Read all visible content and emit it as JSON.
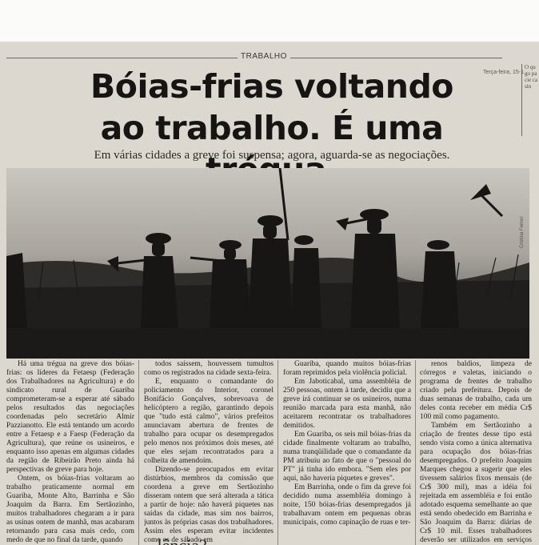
{
  "section": "TRABALHO",
  "date": "Terça-feira, 15-1",
  "headline": {
    "line1": "Bóias-frias voltando",
    "line2": "ao trabalho. É uma trégua."
  },
  "subhead": "Em várias cidades a greve foi suspensa; agora, aguarda-se as negociações.",
  "photo_credit": "Cristina Ferreri",
  "columns": [
    [
      "Há uma trégua na greve dos bóias-frias: os líderes da Fetaesp (Federação dos Trabalhadores na Agricultura) e do sindicato rural de Guariba comprometeram-se a esperar até sábado pelos resultados das negociações coordenadas pelo secretário Almir Pazzianotto. Ele está tentando um acordo entre a Fetaesp e a Faesp (Federação da Agricultura), que reúne os usineiros, e enquanto isso apenas em algumas cidades da região de Ribeirão Preto ainda há perspectivas de greve para hoje.",
      "Ontem, os bóias-frias voltaram ao trabalho praticamente normal em Guariba, Monte Alto, Barrinha e São Joaquim da Barra. Em Sertãozinho, muitos trabalhadores chegaram a ir para as usinas ontem de manhã, mas acabaram retornando para casa mais cedo, com medo de que no final da tarde, quando"
    ],
    [
      "todos saíssem, houvessem tumultos como os registrados na cidade sexta-feira.",
      "E, enquanto o comandante do policiamento do Interior, coronel Bonifácio Gonçalves, sobrevoava de helicóptero a região, garantindo depois que \"tudo está calmo\", vários prefeitos anunciavam abertura de frentes de trabalho para ocupar os desempregados pelo menos nos próximos dois meses, até que eles sejam recontratados para a colheita de amendoim.",
      "Dizendo-se preocupados em evitar distúrbios, membros da comissão que coordena a greve em Sertãozinho disseram ontem que será alterada a tática a partir de hoje: não haverá piquetes nas saídas da cidade, mas sim nos bairros, juntos às próprias casas dos trabalhadores. Assim eles esperam evitar incidentes como os de sábado em"
    ],
    [
      "Guariba, quando muitos bóias-frias foram reprimidos pela violência policial.",
      "Em Jaboticabal, uma assembléia de 250 pessoas, ontem à tarde, decidiu que a greve irá continuar se os usineiros, numa reunião marcada para esta manhã, não aceitarem recontratar os trabalhadores demitidos.",
      "Em Guariba, os seis mil bóias-frias da cidade finalmente voltaram ao trabalho, numa tranqüilidade que o comandante da PM atribuiu ao fato de que o \"pessoal do PT\" já tinha ido embora. \"Sem eles por aqui, não haveria piquetes e greves\".",
      "Em Barrinha, onde o fim da greve foi decidido numa assembléia domingo à noite, 150 bóias-frias desempregados já trabalhavam ontem em pequenas obras municipais, como capinação de ruas e ter-"
    ],
    [
      "renos baldios, limpeza de córregos e valetas, iniciando o programa de frentes de trabalho criado pela prefeitura. Depois de duas semanas de trabalho, cada um deles conta receber em média Cr$ 100 mil como pagamento.",
      "Também em Sertãozinho a criação de frentes desse tipo está sendo vista como a única alternativa para ocupação dos bóias-frias desempregados. O prefeito Joaquim Marques chegou a sugerir que eles tivessem salários fixos mensais (de Cr$ 300 mil), mas a idéia foi rejeitada em assembléia e foi então adotado esquema semelhante ao que está sendo obedecido em Barrinha e São Joaquim da Barra: diárias de Cr$ 10 mil. Esses trabalhadores deverão ser utilizados em serviços como limpeza de ruas, construção de muros e calçadas e construção de casas."
    ]
  ],
  "bottom_fragment": "...lência?",
  "right_strip": "O qu go pa cie ca sin"
}
